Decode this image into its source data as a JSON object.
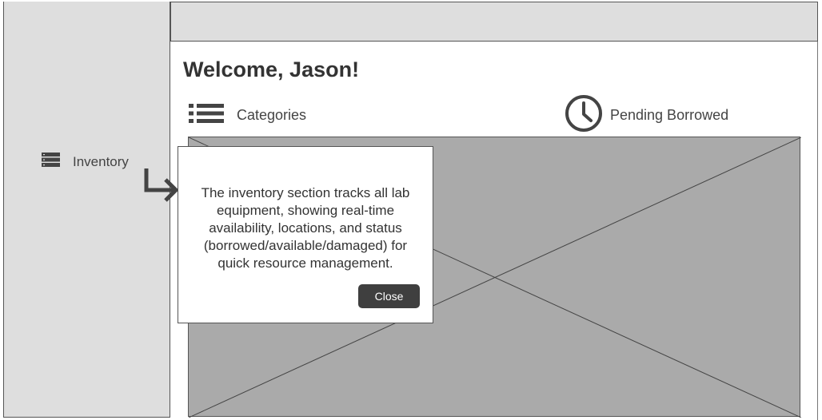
{
  "sidebar": {
    "items": [
      {
        "label": "Inventory",
        "icon": "server-icon"
      }
    ]
  },
  "main": {
    "welcome": "Welcome, Jason!",
    "nav": {
      "categories": {
        "label": "Categories",
        "icon": "list-icon"
      },
      "pending": {
        "label": "Pending Borrowed",
        "icon": "clock-icon"
      }
    },
    "placeholder": {
      "icon": "image-placeholder"
    }
  },
  "tooltip": {
    "text": "The inventory section tracks all lab equipment, showing real-time availability, locations, and status (borrowed/available/damaged) for quick resource management.",
    "close_label": "Close",
    "pointer_icon": "arrow-turn-right-icon"
  },
  "colors": {
    "sidebar_bg": "#dedede",
    "topbar_bg": "#dedede",
    "placeholder_bg": "#aaaaaa",
    "close_button_bg": "#3f3f3f",
    "text": "#333333"
  }
}
